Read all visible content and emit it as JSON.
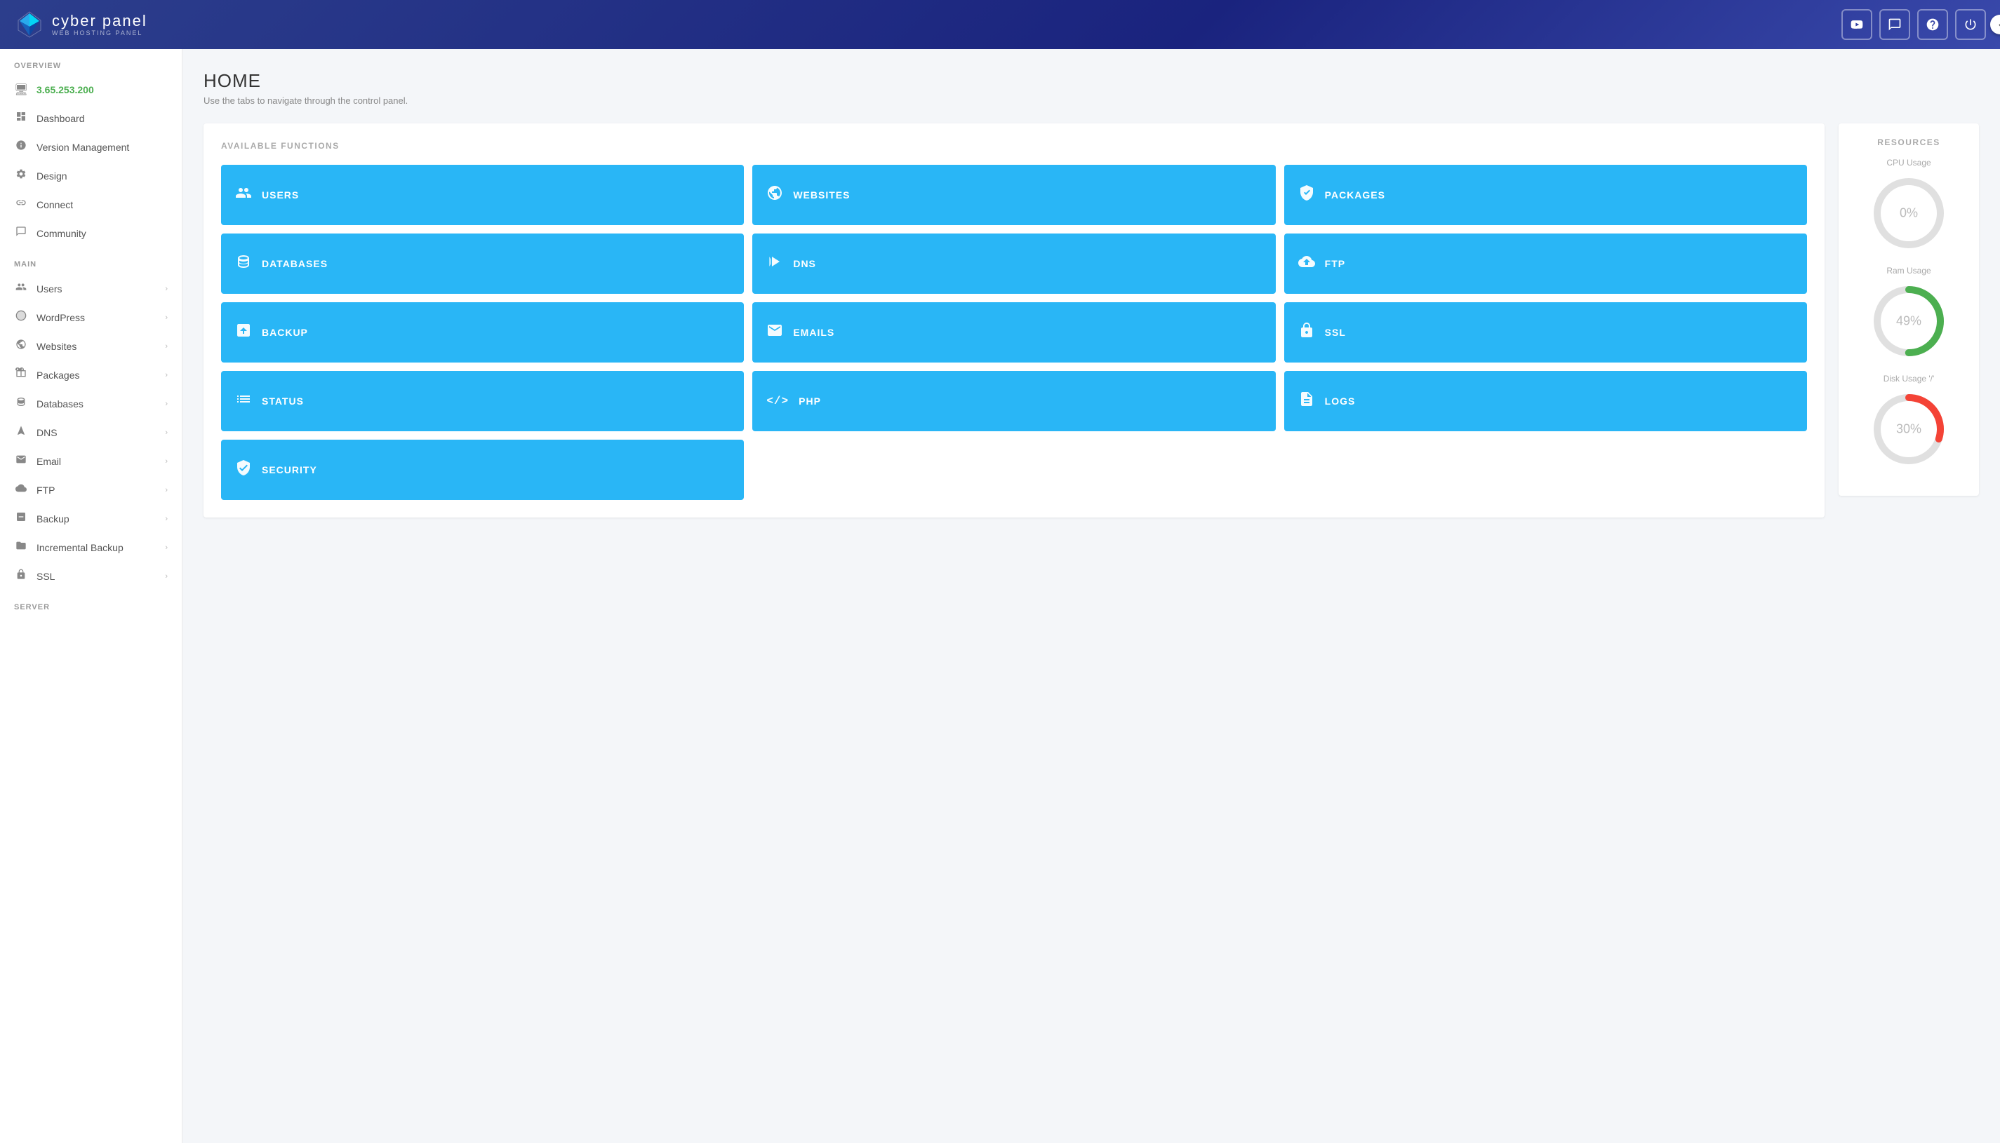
{
  "header": {
    "logo_name": "cyber panel",
    "logo_sub": "WEB HOSTING PANEL",
    "toggle_icon": "‹",
    "icons": [
      {
        "name": "youtube-icon",
        "symbol": "▶",
        "label": "YouTube"
      },
      {
        "name": "chat-icon",
        "symbol": "💬",
        "label": "Chat"
      },
      {
        "name": "support-icon",
        "symbol": "⊕",
        "label": "Support"
      },
      {
        "name": "power-icon",
        "symbol": "⏻",
        "label": "Power"
      }
    ]
  },
  "sidebar": {
    "overview_label": "OVERVIEW",
    "main_label": "MAIN",
    "server_label": "SERVER",
    "ip_address": "3.65.253.200",
    "overview_items": [
      {
        "label": "Dashboard",
        "icon": "🖥"
      },
      {
        "label": "Version Management",
        "icon": "ℹ"
      },
      {
        "label": "Design",
        "icon": "⚙"
      },
      {
        "label": "Connect",
        "icon": "🔗"
      },
      {
        "label": "Community",
        "icon": "💬"
      }
    ],
    "main_items": [
      {
        "label": "Users",
        "has_arrow": true
      },
      {
        "label": "WordPress",
        "has_arrow": true
      },
      {
        "label": "Websites",
        "has_arrow": true
      },
      {
        "label": "Packages",
        "has_arrow": true
      },
      {
        "label": "Databases",
        "has_arrow": true
      },
      {
        "label": "DNS",
        "has_arrow": true
      },
      {
        "label": "Email",
        "has_arrow": true
      },
      {
        "label": "FTP",
        "has_arrow": true
      },
      {
        "label": "Backup",
        "has_arrow": true
      },
      {
        "label": "Incremental Backup",
        "has_arrow": true
      },
      {
        "label": "SSL",
        "has_arrow": true
      }
    ]
  },
  "page": {
    "title": "HOME",
    "subtitle": "Use the tabs to navigate through the control panel."
  },
  "functions": {
    "section_title": "AVAILABLE FUNCTIONS",
    "buttons": [
      {
        "label": "USERS",
        "icon": "👥"
      },
      {
        "label": "WEBSITES",
        "icon": "🌐"
      },
      {
        "label": "PACKAGES",
        "icon": "📦"
      },
      {
        "label": "DATABASES",
        "icon": "🗄"
      },
      {
        "label": "DNS",
        "icon": "🔀"
      },
      {
        "label": "FTP",
        "icon": "☁"
      },
      {
        "label": "BACKUP",
        "icon": "📋"
      },
      {
        "label": "EMAILS",
        "icon": "✉"
      },
      {
        "label": "SSL",
        "icon": "🔒"
      },
      {
        "label": "STATUS",
        "icon": "≡"
      },
      {
        "label": "PHP",
        "icon": "</>"
      },
      {
        "label": "LOGS",
        "icon": "📄"
      },
      {
        "label": "SECURITY",
        "icon": "🛡"
      }
    ]
  },
  "resources": {
    "title": "RESOURCES",
    "cpu": {
      "label": "CPU Usage",
      "value": 0,
      "display": "0%",
      "color": "#e0e0e0",
      "track_color": "#e0e0e0"
    },
    "ram": {
      "label": "Ram Usage",
      "value": 49,
      "display": "49%",
      "color": "#4caf50",
      "track_color": "#e0e0e0"
    },
    "disk": {
      "label": "Disk Usage '/'",
      "value": 30,
      "display": "30%",
      "color": "#f44336",
      "track_color": "#e0e0e0"
    }
  }
}
